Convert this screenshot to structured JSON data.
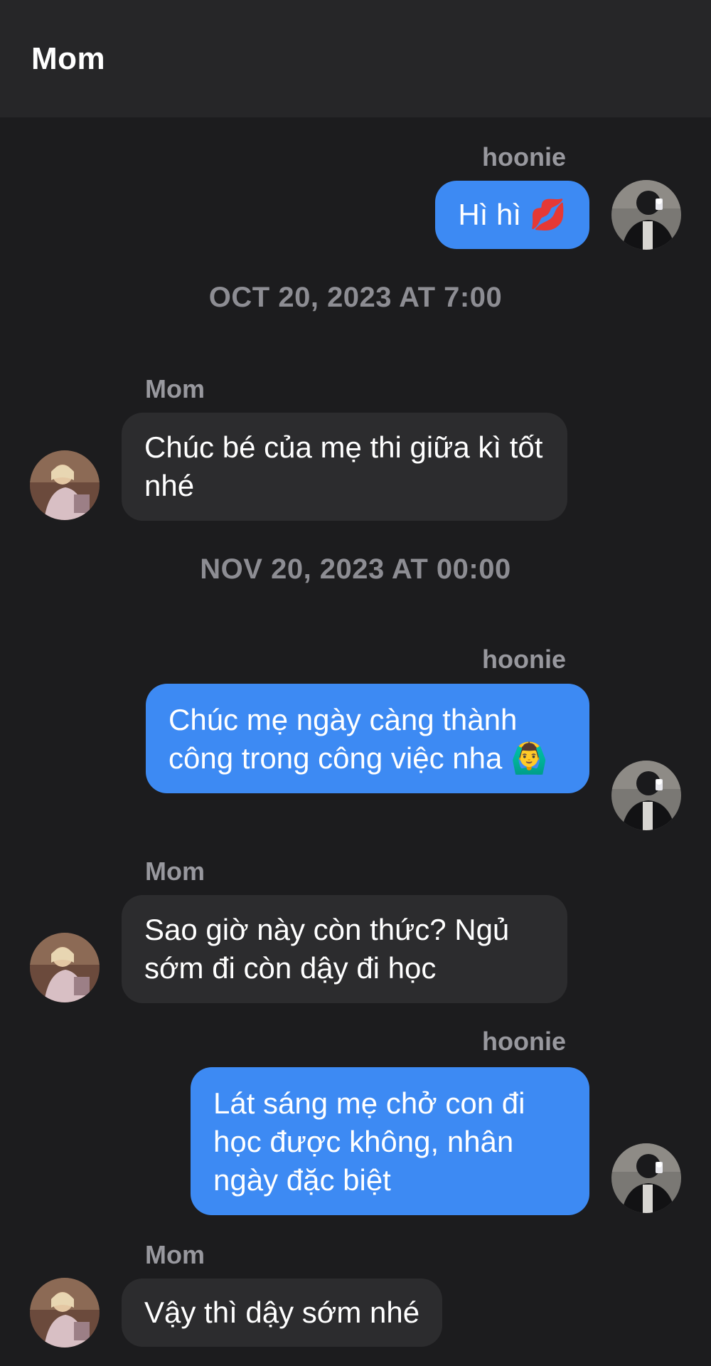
{
  "header": {
    "title": "Mom"
  },
  "messages": [
    {
      "type": "outgoing",
      "sender": "hoonie",
      "text": "Hì hì 💋"
    },
    {
      "type": "timestamp",
      "text": "OCT 20, 2023 AT 7:00"
    },
    {
      "type": "incoming",
      "sender": "Mom",
      "text": "Chúc bé của mẹ thi giữa kì tốt nhé"
    },
    {
      "type": "timestamp",
      "text": "NOV 20, 2023 AT 00:00"
    },
    {
      "type": "outgoing",
      "sender": "hoonie",
      "text": "Chúc mẹ ngày càng thành công trong công việc nha 🙆‍♂️"
    },
    {
      "type": "incoming",
      "sender": "Mom",
      "text": "Sao giờ này còn thức? Ngủ sớm đi còn dậy đi học"
    },
    {
      "type": "outgoing",
      "sender": "hoonie",
      "text": "Lát sáng mẹ chở con đi học được không, nhân ngày đặc biệt"
    },
    {
      "type": "incoming",
      "sender": "Mom",
      "text": "Vậy thì dậy sớm nhé"
    }
  ]
}
